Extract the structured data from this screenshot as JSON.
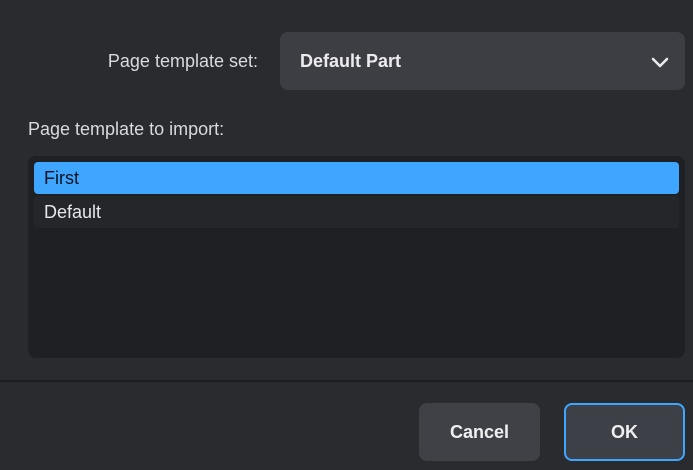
{
  "dialog": {
    "template_set": {
      "label": "Page template set:",
      "selected_value": "Default Part",
      "dropdown_icon": "chevron-down-icon"
    },
    "import": {
      "label": "Page template to import:",
      "items": [
        {
          "label": "First",
          "selected": true
        },
        {
          "label": "Default",
          "selected": false
        }
      ]
    },
    "buttons": {
      "cancel_label": "Cancel",
      "ok_label": "OK"
    }
  },
  "colors": {
    "accent": "#3ea6ff",
    "background": "#2a2b2f",
    "list_background": "#1f2023",
    "control_background": "#3c3e44"
  }
}
